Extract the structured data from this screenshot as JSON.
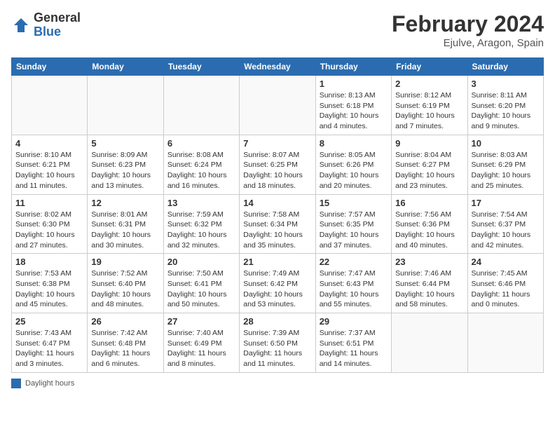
{
  "logo": {
    "general": "General",
    "blue": "Blue"
  },
  "header": {
    "title": "February 2024",
    "subtitle": "Ejulve, Aragon, Spain"
  },
  "columns": [
    "Sunday",
    "Monday",
    "Tuesday",
    "Wednesday",
    "Thursday",
    "Friday",
    "Saturday"
  ],
  "weeks": [
    [
      {
        "day": "",
        "info": ""
      },
      {
        "day": "",
        "info": ""
      },
      {
        "day": "",
        "info": ""
      },
      {
        "day": "",
        "info": ""
      },
      {
        "day": "1",
        "info": "Sunrise: 8:13 AM\nSunset: 6:18 PM\nDaylight: 10 hours\nand 4 minutes."
      },
      {
        "day": "2",
        "info": "Sunrise: 8:12 AM\nSunset: 6:19 PM\nDaylight: 10 hours\nand 7 minutes."
      },
      {
        "day": "3",
        "info": "Sunrise: 8:11 AM\nSunset: 6:20 PM\nDaylight: 10 hours\nand 9 minutes."
      }
    ],
    [
      {
        "day": "4",
        "info": "Sunrise: 8:10 AM\nSunset: 6:21 PM\nDaylight: 10 hours\nand 11 minutes."
      },
      {
        "day": "5",
        "info": "Sunrise: 8:09 AM\nSunset: 6:23 PM\nDaylight: 10 hours\nand 13 minutes."
      },
      {
        "day": "6",
        "info": "Sunrise: 8:08 AM\nSunset: 6:24 PM\nDaylight: 10 hours\nand 16 minutes."
      },
      {
        "day": "7",
        "info": "Sunrise: 8:07 AM\nSunset: 6:25 PM\nDaylight: 10 hours\nand 18 minutes."
      },
      {
        "day": "8",
        "info": "Sunrise: 8:05 AM\nSunset: 6:26 PM\nDaylight: 10 hours\nand 20 minutes."
      },
      {
        "day": "9",
        "info": "Sunrise: 8:04 AM\nSunset: 6:27 PM\nDaylight: 10 hours\nand 23 minutes."
      },
      {
        "day": "10",
        "info": "Sunrise: 8:03 AM\nSunset: 6:29 PM\nDaylight: 10 hours\nand 25 minutes."
      }
    ],
    [
      {
        "day": "11",
        "info": "Sunrise: 8:02 AM\nSunset: 6:30 PM\nDaylight: 10 hours\nand 27 minutes."
      },
      {
        "day": "12",
        "info": "Sunrise: 8:01 AM\nSunset: 6:31 PM\nDaylight: 10 hours\nand 30 minutes."
      },
      {
        "day": "13",
        "info": "Sunrise: 7:59 AM\nSunset: 6:32 PM\nDaylight: 10 hours\nand 32 minutes."
      },
      {
        "day": "14",
        "info": "Sunrise: 7:58 AM\nSunset: 6:34 PM\nDaylight: 10 hours\nand 35 minutes."
      },
      {
        "day": "15",
        "info": "Sunrise: 7:57 AM\nSunset: 6:35 PM\nDaylight: 10 hours\nand 37 minutes."
      },
      {
        "day": "16",
        "info": "Sunrise: 7:56 AM\nSunset: 6:36 PM\nDaylight: 10 hours\nand 40 minutes."
      },
      {
        "day": "17",
        "info": "Sunrise: 7:54 AM\nSunset: 6:37 PM\nDaylight: 10 hours\nand 42 minutes."
      }
    ],
    [
      {
        "day": "18",
        "info": "Sunrise: 7:53 AM\nSunset: 6:38 PM\nDaylight: 10 hours\nand 45 minutes."
      },
      {
        "day": "19",
        "info": "Sunrise: 7:52 AM\nSunset: 6:40 PM\nDaylight: 10 hours\nand 48 minutes."
      },
      {
        "day": "20",
        "info": "Sunrise: 7:50 AM\nSunset: 6:41 PM\nDaylight: 10 hours\nand 50 minutes."
      },
      {
        "day": "21",
        "info": "Sunrise: 7:49 AM\nSunset: 6:42 PM\nDaylight: 10 hours\nand 53 minutes."
      },
      {
        "day": "22",
        "info": "Sunrise: 7:47 AM\nSunset: 6:43 PM\nDaylight: 10 hours\nand 55 minutes."
      },
      {
        "day": "23",
        "info": "Sunrise: 7:46 AM\nSunset: 6:44 PM\nDaylight: 10 hours\nand 58 minutes."
      },
      {
        "day": "24",
        "info": "Sunrise: 7:45 AM\nSunset: 6:46 PM\nDaylight: 11 hours\nand 0 minutes."
      }
    ],
    [
      {
        "day": "25",
        "info": "Sunrise: 7:43 AM\nSunset: 6:47 PM\nDaylight: 11 hours\nand 3 minutes."
      },
      {
        "day": "26",
        "info": "Sunrise: 7:42 AM\nSunset: 6:48 PM\nDaylight: 11 hours\nand 6 minutes."
      },
      {
        "day": "27",
        "info": "Sunrise: 7:40 AM\nSunset: 6:49 PM\nDaylight: 11 hours\nand 8 minutes."
      },
      {
        "day": "28",
        "info": "Sunrise: 7:39 AM\nSunset: 6:50 PM\nDaylight: 11 hours\nand 11 minutes."
      },
      {
        "day": "29",
        "info": "Sunrise: 7:37 AM\nSunset: 6:51 PM\nDaylight: 11 hours\nand 14 minutes."
      },
      {
        "day": "",
        "info": ""
      },
      {
        "day": "",
        "info": ""
      }
    ]
  ],
  "footer": {
    "legend_label": "Daylight hours"
  }
}
